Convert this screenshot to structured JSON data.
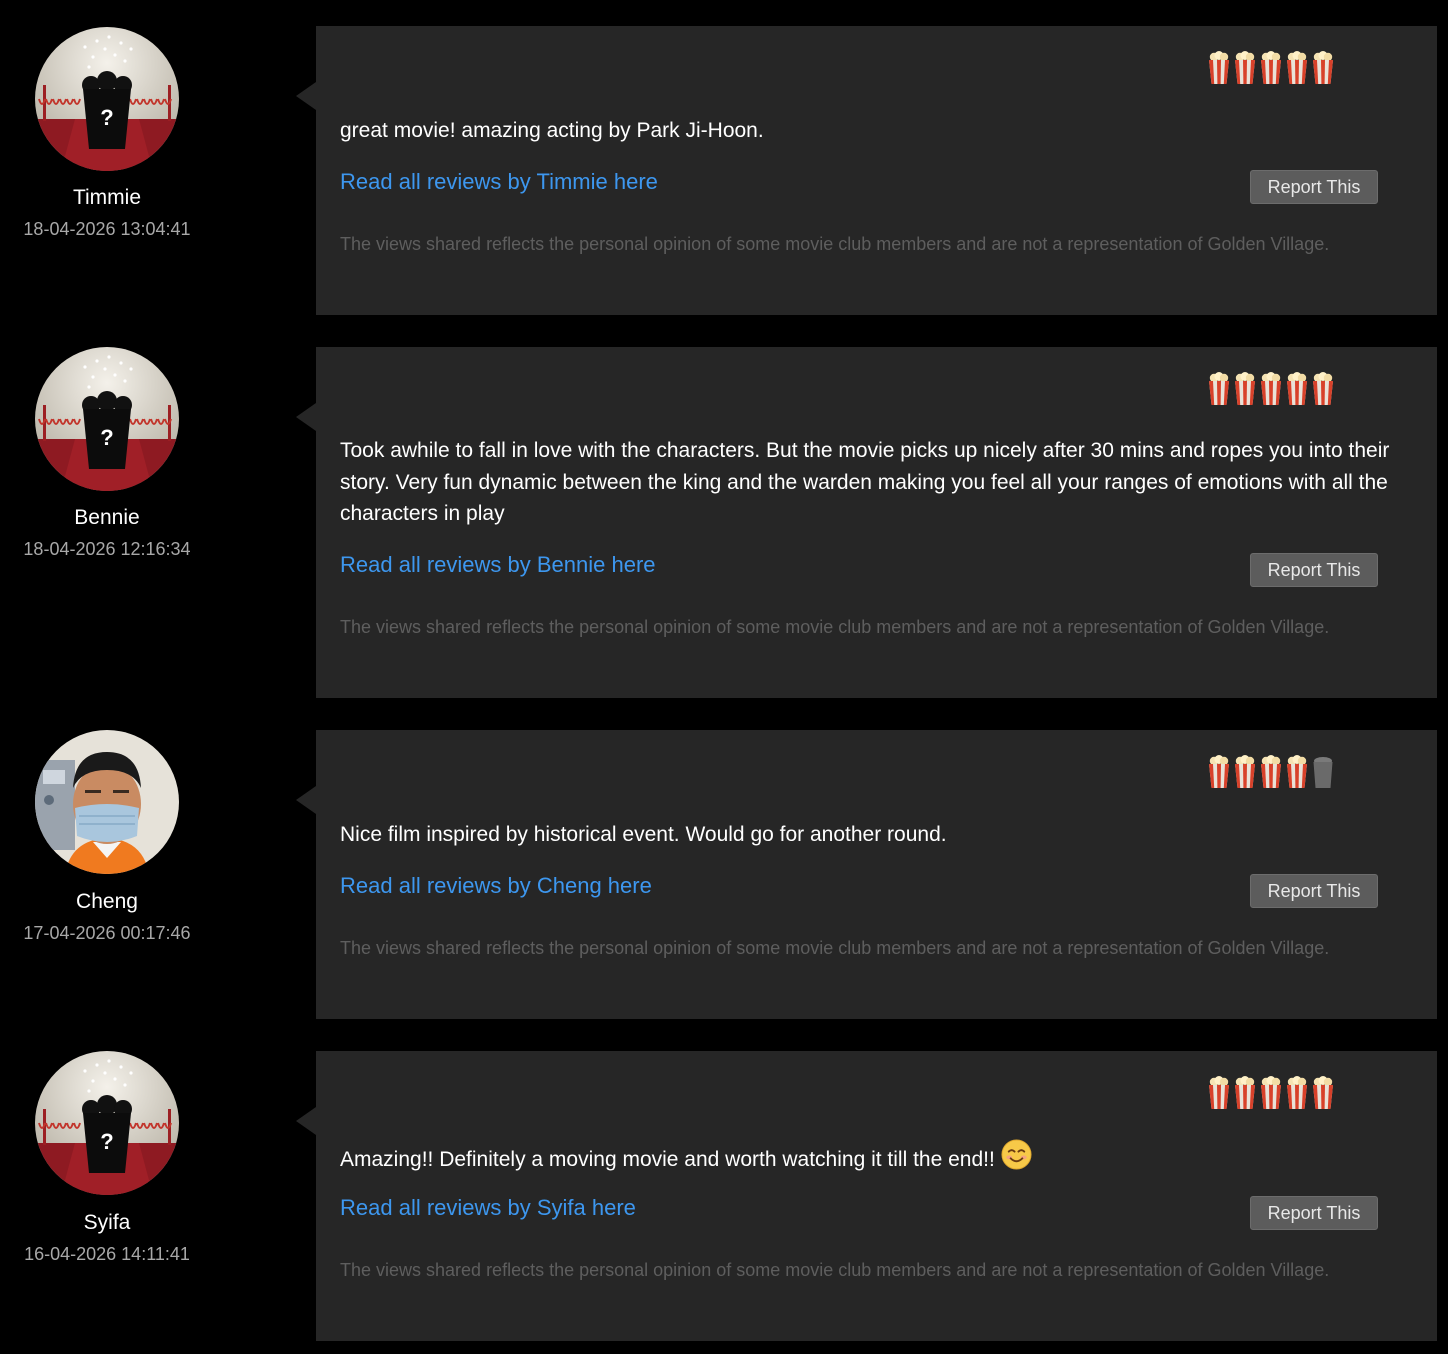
{
  "reviews": [
    {
      "author": "Timmie",
      "date": "18-04-2026 13:04:41",
      "avatar_icon": "default-popcorn-avatar-icon",
      "rating": 5,
      "rating_max": 5,
      "text": "great movie! amazing acting by Park Ji-Hoon.",
      "read_link": "Read all reviews by Timmie here",
      "report_label": "Report This",
      "disclaimer": "The views shared reflects the personal opinion of some movie club members and are not a representation of Golden Village."
    },
    {
      "author": "Bennie",
      "date": "18-04-2026 12:16:34",
      "avatar_icon": "default-popcorn-avatar-icon",
      "rating": 5,
      "rating_max": 5,
      "text": "Took awhile to fall in love with the characters. But the movie picks up nicely after 30 mins and ropes you into their story. Very fun dynamic between the king and the warden making you feel all your ranges of emotions with all the characters in play",
      "read_link": "Read all reviews by Bennie here",
      "report_label": "Report This",
      "disclaimer": "The views shared reflects the personal opinion of some movie club members and are not a representation of Golden Village."
    },
    {
      "author": "Cheng",
      "date": "17-04-2026 00:17:46",
      "avatar_icon": "user-photo-avatar",
      "rating": 4,
      "rating_max": 5,
      "text": "Nice film inspired by historical event. Would go for another round.",
      "read_link": "Read all reviews by Cheng here",
      "report_label": "Report This",
      "disclaimer": "The views shared reflects the personal opinion of some movie club members and are not a representation of Golden Village."
    },
    {
      "author": "Syifa",
      "date": "16-04-2026 14:11:41",
      "avatar_icon": "default-popcorn-avatar-icon",
      "rating": 5,
      "rating_max": 5,
      "text": "Amazing!! Definitely a moving movie and worth watching it till the end!!",
      "text_emoji": "smiling-face-emoji",
      "read_link": "Read all reviews by Syifa here",
      "report_label": "Report This",
      "disclaimer": "The views shared reflects the personal opinion of some movie club members and are not a representation of Golden Village."
    }
  ],
  "colors": {
    "background": "#000000",
    "card": "#262626",
    "link": "#3d97ef",
    "disclaimer": "#5e5e5e",
    "date": "#a8a8a8",
    "popcorn_red": "#d8412a",
    "popcorn_empty": "#6a6a6a"
  }
}
